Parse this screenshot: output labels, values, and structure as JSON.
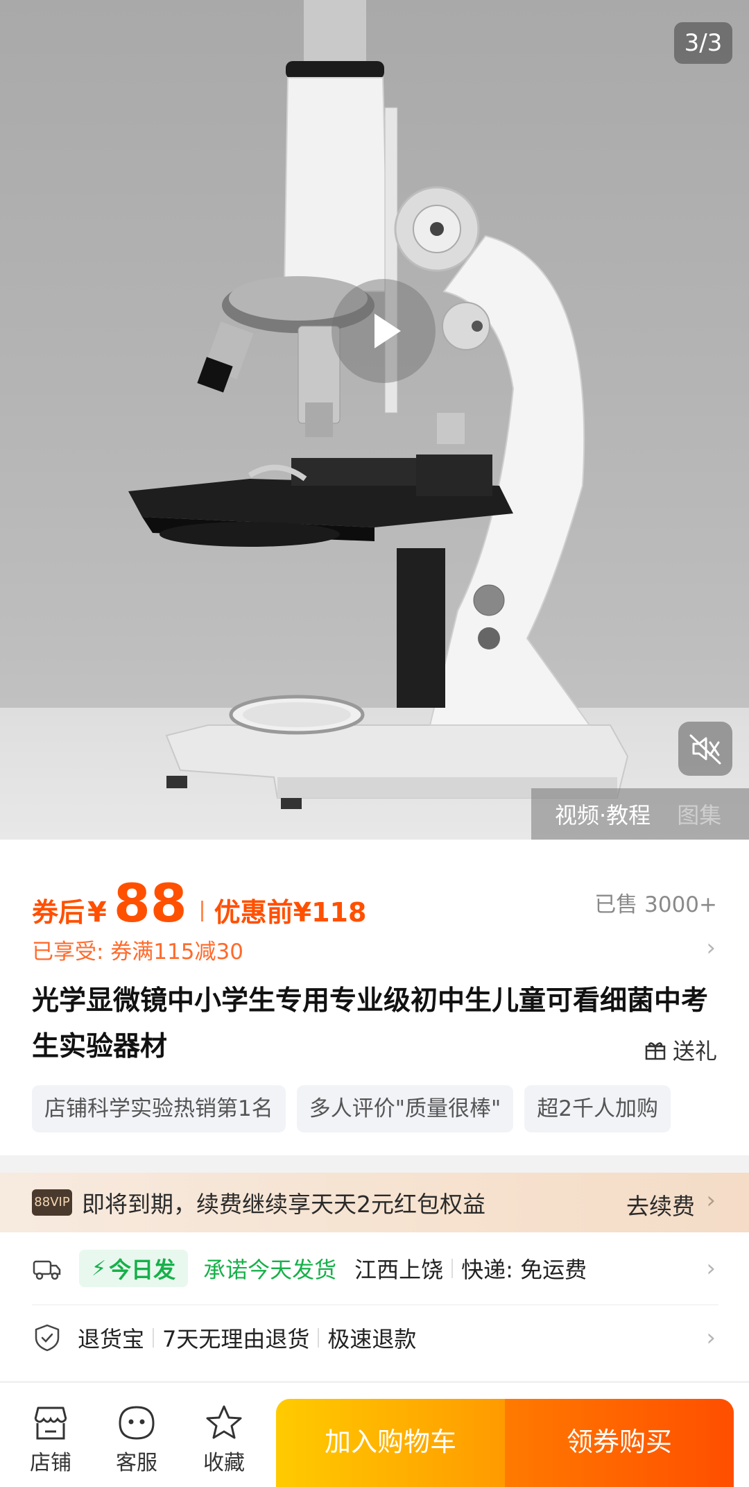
{
  "gallery": {
    "page_counter": "3/3",
    "tabs": {
      "video": "视频·教程",
      "gallery": "图集"
    }
  },
  "price": {
    "coupon_prefix": "券后",
    "currency": "¥",
    "value": "88",
    "original": "优惠前¥118",
    "sold": "已售 3000+"
  },
  "promo": {
    "text": "已享受: 券满115减30"
  },
  "product": {
    "title": "光学显微镜中小学生专用专业级初中生儿童可看细菌中考生实验器材",
    "gift_label": "送礼"
  },
  "tags": [
    "店铺科学实验热销第1名",
    "多人评价\"质量很棒\"",
    "超2千人加购"
  ],
  "vip": {
    "badge": "88VIP",
    "text": "即将到期，续费继续享天天2元红包权益",
    "action": "去续费"
  },
  "shipping": {
    "today_badge": "今日发",
    "promise": "承诺今天发货",
    "origin": "江西上饶",
    "express": "快递: 免运费"
  },
  "returns": {
    "items": [
      "退货宝",
      "7天无理由退货",
      "极速退款"
    ]
  },
  "bottom": {
    "store": "店铺",
    "service": "客服",
    "favorite": "收藏",
    "add_to_cart": "加入购物车",
    "buy_now": "领券购买"
  },
  "colors": {
    "accent": "#ff5000",
    "green": "#17b04a",
    "cart": "#ffb000",
    "buy": "#ff5a00"
  }
}
